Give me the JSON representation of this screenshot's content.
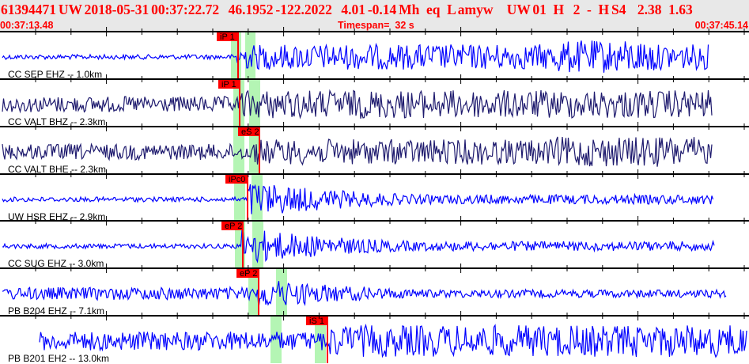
{
  "header": {
    "title": "61394471 UW 2018-05-31 00:37:22.72    46.1952 -122.2022    4.01 -0.14 Mh   eq   L amyw      UW 01   H    2   -   H S4     2.38   1.63",
    "start_time": "00:37:13.48",
    "timespan": "Timespan=  32 s",
    "end_time": "00:37:45.14"
  },
  "colors": {
    "header_text": "#ff0000",
    "trace_blue": "#0000ff",
    "trace_navy": "#1e1a6e",
    "pick": "#ff0000",
    "window": "#b4f5b4"
  },
  "channels": [
    {
      "label": "CC SEP EHZ -- 1.0km",
      "pick": "iP 1",
      "color": "trace_blue"
    },
    {
      "label": "CC VALT BHZ -- 2.3km",
      "pick": "iP 1",
      "color": "trace_navy"
    },
    {
      "label": "CC VALT BHE -- 2.3km",
      "pick": "eS 2",
      "color": "trace_navy"
    },
    {
      "label": "UW HSR EHZ -- 2.9km",
      "pick": "iPc0",
      "color": "trace_blue"
    },
    {
      "label": "CC SUG EHZ -- 3.0km",
      "pick": "eP 2",
      "color": "trace_blue"
    },
    {
      "label": "PB B204 EHZ -- 7.1km",
      "pick": "eP 2",
      "color": "trace_blue"
    },
    {
      "label": "PB B201 EH2 -- 13.0km",
      "pick": "iS 1",
      "color": "trace_blue"
    }
  ]
}
